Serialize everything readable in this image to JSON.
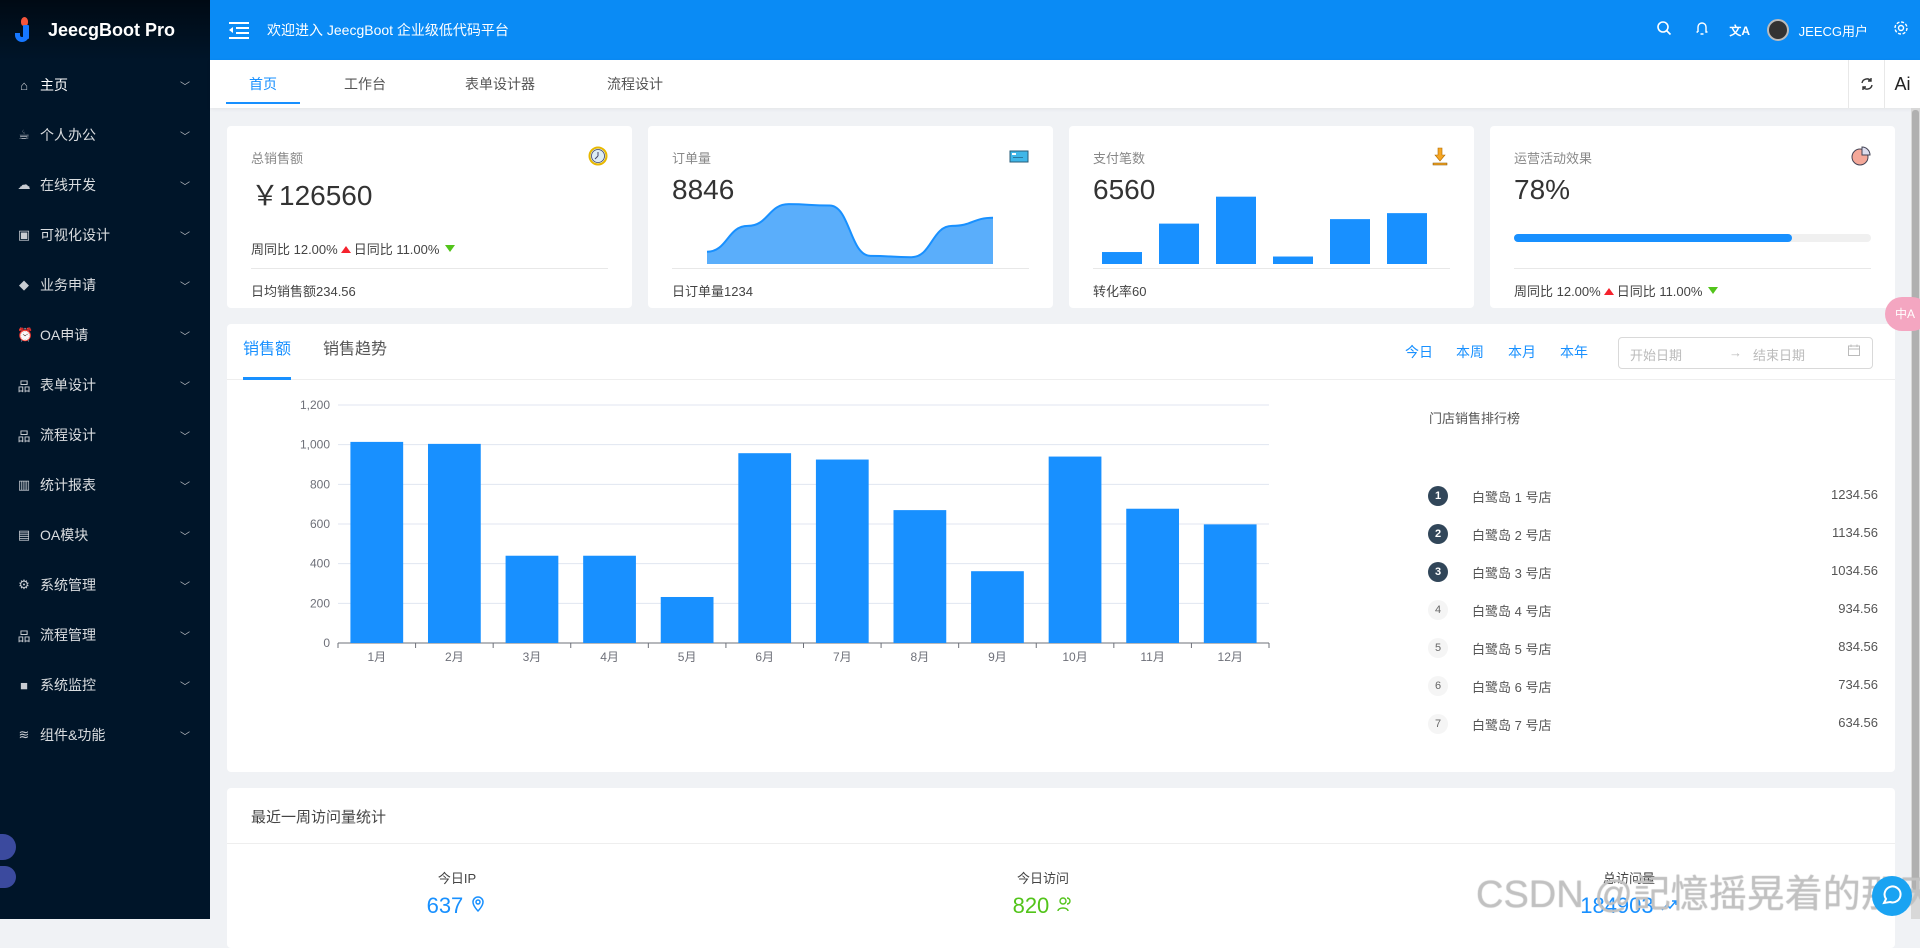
{
  "app": {
    "name": "JeecgBoot Pro",
    "welcome": "欢迎进入 JeecgBoot 企业级低代码平台",
    "user": "JEECG用户"
  },
  "sidebar": {
    "items": [
      {
        "label": "主页",
        "icon": "home-icon"
      },
      {
        "label": "个人办公",
        "icon": "coffee-icon"
      },
      {
        "label": "在线开发",
        "icon": "cloud-icon"
      },
      {
        "label": "可视化设计",
        "icon": "layout-icon"
      },
      {
        "label": "业务申请",
        "icon": "tag-icon"
      },
      {
        "label": "OA申请",
        "icon": "alarm-icon"
      },
      {
        "label": "表单设计",
        "icon": "cluster-icon"
      },
      {
        "label": "流程设计",
        "icon": "flow-icon"
      },
      {
        "label": "统计报表",
        "icon": "bar-chart-icon"
      },
      {
        "label": "OA模块",
        "icon": "file-icon"
      },
      {
        "label": "系统管理",
        "icon": "setting-icon"
      },
      {
        "label": "流程管理",
        "icon": "flow-icon"
      },
      {
        "label": "系统监控",
        "icon": "video-camera-icon"
      },
      {
        "label": "组件&功能",
        "icon": "layers-icon"
      }
    ]
  },
  "tabs": [
    {
      "label": "首页",
      "active": true
    },
    {
      "label": "工作台"
    },
    {
      "label": "表单设计器"
    },
    {
      "label": "流程设计"
    }
  ],
  "tabbar_right": {
    "refresh": "⟳",
    "ai": "Ai"
  },
  "cards": [
    {
      "title": "总销售额",
      "value": "￥126560",
      "week": "周同比 12.00%",
      "day": "日同比 11.00%",
      "footer": "日均销售额234.56",
      "icon": "clock-icon"
    },
    {
      "title": "订单量",
      "value": "8846",
      "footer": "日订单量1234",
      "icon": "credit-card-icon",
      "mini_area": [
        9,
        28,
        44,
        43,
        6,
        5,
        28,
        34
      ]
    },
    {
      "title": "支付笔数",
      "value": "6560",
      "footer": "转化率60",
      "icon": "download-icon",
      "mini_bars": [
        8,
        27,
        45,
        5,
        30,
        34
      ]
    },
    {
      "title": "运营活动效果",
      "value": "78%",
      "progress": 0.78,
      "week": "周同比 12.00%",
      "day": "日同比 11.00%",
      "icon": "pie-chart-icon"
    }
  ],
  "sales": {
    "tabs": [
      "销售额",
      "销售趋势"
    ],
    "ranges": [
      "今日",
      "本周",
      "本月",
      "本年"
    ],
    "date_start_placeholder": "开始日期",
    "date_end_placeholder": "结束日期",
    "arrow": "→",
    "ranking_title": "门店销售排行榜",
    "ranking": [
      {
        "rank": "1",
        "name": "白鹭岛 1 号店",
        "value": "1234.56"
      },
      {
        "rank": "2",
        "name": "白鹭岛 2 号店",
        "value": "1134.56"
      },
      {
        "rank": "3",
        "name": "白鹭岛 3 号店",
        "value": "1034.56"
      },
      {
        "rank": "4",
        "name": "白鹭岛 4 号店",
        "value": "934.56"
      },
      {
        "rank": "5",
        "name": "白鹭岛 5 号店",
        "value": "834.56"
      },
      {
        "rank": "6",
        "name": "白鹭岛 6 号店",
        "value": "734.56"
      },
      {
        "rank": "7",
        "name": "白鹭岛 7 号店",
        "value": "634.56"
      }
    ]
  },
  "chart_data": {
    "type": "bar",
    "title": "",
    "xlabel": "",
    "ylabel": "",
    "categories": [
      "1月",
      "2月",
      "3月",
      "4月",
      "5月",
      "6月",
      "7月",
      "8月",
      "9月",
      "10月",
      "11月",
      "12月"
    ],
    "values": [
      1014,
      1004,
      440,
      440,
      232,
      957,
      925,
      670,
      362,
      940,
      677,
      598
    ],
    "ylim": [
      0,
      1200
    ],
    "yticks": [
      "0",
      "200",
      "400",
      "600",
      "800",
      "1,000",
      "1,200"
    ],
    "grid": true,
    "color": "#1890ff"
  },
  "visits": {
    "title": "最近一周访问量统计",
    "stats": [
      {
        "label": "今日IP",
        "value": "637",
        "icon": "location-icon",
        "color": "#1890ff"
      },
      {
        "label": "今日访问",
        "value": "820",
        "icon": "users-icon",
        "color": "#52c41a"
      },
      {
        "label": "总访问量",
        "value": "184903",
        "icon": "trend-up-icon",
        "color": "#1890ff"
      }
    ]
  },
  "watermark": "CSDN @記憶摇晃着的那天",
  "translate_badge": "中A"
}
